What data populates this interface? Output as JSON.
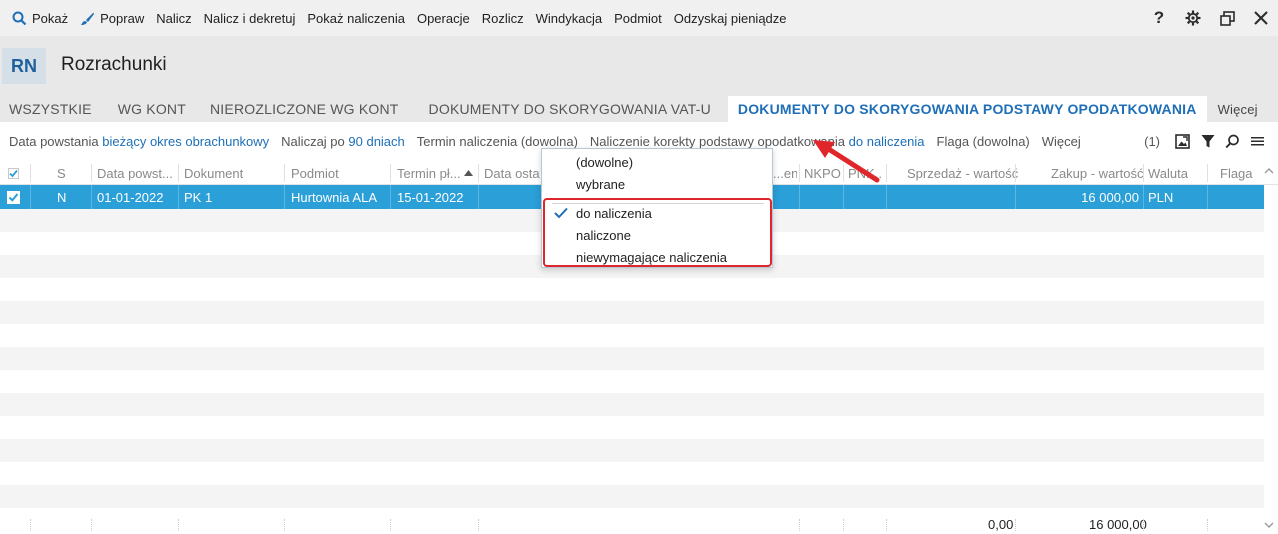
{
  "toolbar": {
    "items": [
      "Pokaż",
      "Popraw",
      "Nalicz",
      "Nalicz i dekretuj",
      "Pokaż naliczenia",
      "Operacje",
      "Rozlicz",
      "Windykacja",
      "Podmiot",
      "Odzyskaj pieniądze"
    ],
    "help": "?"
  },
  "header": {
    "badge": "RN",
    "title": "Rozrachunki"
  },
  "tabs": [
    "WSZYSTKIE",
    "WG KONT",
    "NIEROZLICZONE WG KONT",
    "DOKUMENTY DO SKORYGOWANIA VAT-U",
    "DOKUMENTY DO SKORYGOWANIA PODSTAWY OPODATKOWANIA",
    "Więcej"
  ],
  "filters": {
    "f1_label": "Data powstania",
    "f1_value": "bieżący okres obrachunkowy",
    "f2_label": "Naliczaj po",
    "f2_value": "90 dniach",
    "f3": "Termin naliczenia (dowolna)",
    "f4_label": "Naliczenie korekty podstawy opodatkowania",
    "f4_value": "do naliczenia",
    "f5": "Flaga (dowolna)",
    "f6": "Więcej",
    "count": "(1)"
  },
  "columns": [
    "S",
    "Data powst...",
    "Dokument",
    "Podmiot",
    "Termin pł...",
    "Data ostat",
    "...eni...",
    "NKPO",
    "PNK...",
    "Sprzedaż - wartość",
    "Zakup - wartość",
    "Waluta",
    "Flaga"
  ],
  "rows": [
    {
      "s": "N",
      "data": "01-01-2022",
      "dokument": "PK 1",
      "podmiot": "Hurtownia ALA",
      "termin": "15-01-2022",
      "zakup": "16 000,00",
      "waluta": "PLN"
    }
  ],
  "footer": {
    "sprzedaz": "0,00",
    "zakup": "16 000,00"
  },
  "dropdown": {
    "options": [
      "(dowolne)",
      "wybrane",
      "do naliczenia",
      "naliczone",
      "niewymagające naliczenia"
    ],
    "selected": "do naliczenia"
  },
  "colors": {
    "accent": "#1e6fb8",
    "selection": "#2a9fd8",
    "highlight": "#e0262a"
  }
}
